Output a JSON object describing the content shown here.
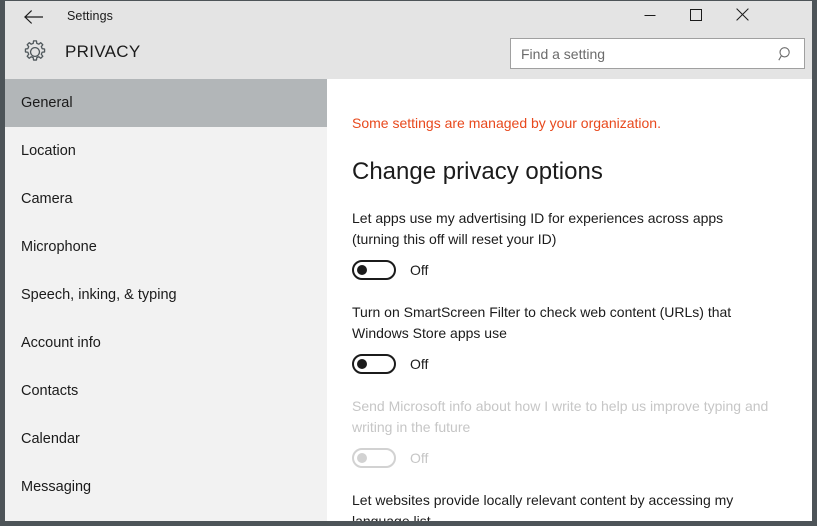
{
  "window": {
    "title": "Settings",
    "back_icon": "back-arrow-icon",
    "controls": {
      "minimize": "minimize-icon",
      "maximize": "maximize-icon",
      "close": "close-icon"
    }
  },
  "header": {
    "icon": "gear-icon",
    "title": "PRIVACY",
    "search": {
      "placeholder": "Find a setting",
      "value": "",
      "icon": "search-icon"
    }
  },
  "sidebar": {
    "items": [
      {
        "label": "General",
        "selected": true
      },
      {
        "label": "Location",
        "selected": false
      },
      {
        "label": "Camera",
        "selected": false
      },
      {
        "label": "Microphone",
        "selected": false
      },
      {
        "label": "Speech, inking, & typing",
        "selected": false
      },
      {
        "label": "Account info",
        "selected": false
      },
      {
        "label": "Contacts",
        "selected": false
      },
      {
        "label": "Calendar",
        "selected": false
      },
      {
        "label": "Messaging",
        "selected": false
      }
    ]
  },
  "main": {
    "managed_notice": "Some settings are managed by your organization.",
    "heading": "Change privacy options",
    "settings": [
      {
        "label": "Let apps use my advertising ID for experiences across apps (turning this off will reset your ID)",
        "state": "Off",
        "enabled": true,
        "has_toggle": true
      },
      {
        "label": "Turn on SmartScreen Filter to check web content (URLs) that Windows Store apps use",
        "state": "Off",
        "enabled": true,
        "has_toggle": true
      },
      {
        "label": "Send Microsoft info about how I write to help us improve typing and writing in the future",
        "state": "Off",
        "enabled": false,
        "has_toggle": true
      },
      {
        "label": "Let websites provide locally relevant content by accessing my language list",
        "state": "",
        "enabled": true,
        "has_toggle": false
      }
    ]
  },
  "colors": {
    "notice": "#e8491d",
    "chrome": "#e4e4e4",
    "sidebar": "#f2f2f2",
    "selected": "#b2b6b8",
    "border": "#4d5458"
  }
}
